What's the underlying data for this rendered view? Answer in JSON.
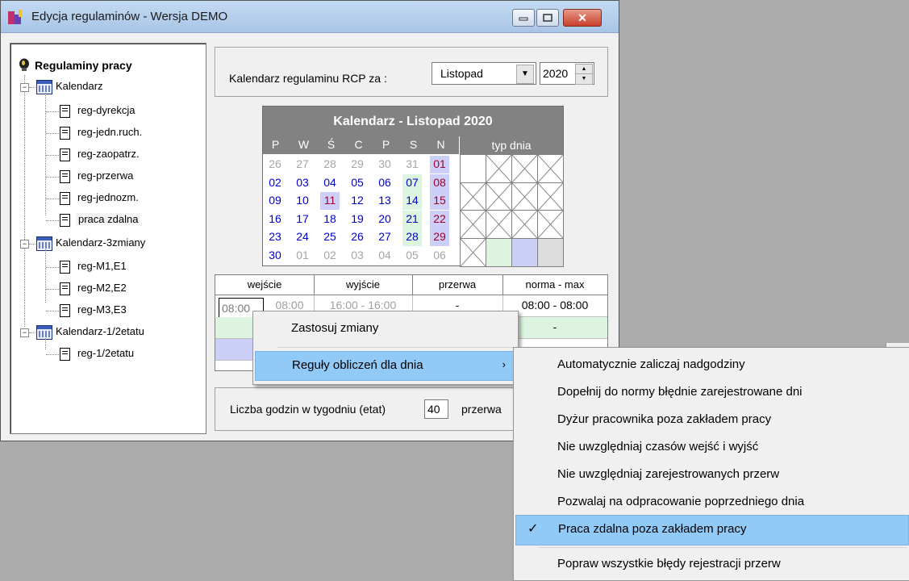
{
  "window": {
    "title": "Edycja regulaminów - Wersja DEMO",
    "buttons": {
      "minimize": "▭",
      "maximize": "▢",
      "close": "✕"
    }
  },
  "tree": {
    "root": "Regulaminy pracy",
    "groups": [
      {
        "label": "Kalendarz",
        "expander": "−",
        "items": [
          "reg-dyrekcja",
          "reg-jedn.ruch.",
          "reg-zaopatrz.",
          "reg-przerwa",
          "reg-jednozm.",
          "praca zdalna"
        ]
      },
      {
        "label": "Kalendarz-3zmiany",
        "expander": "−",
        "items": [
          "reg-M1,E1",
          "reg-M2,E2",
          "reg-M3,E3"
        ]
      },
      {
        "label": "Kalendarz-1/2etatu",
        "expander": "−",
        "items": [
          "reg-1/2etatu"
        ]
      }
    ],
    "selected": "praca zdalna"
  },
  "header": {
    "label": "Kalendarz regulaminu RCP  za :",
    "month": "Listopad",
    "year": "2020",
    "dropdown_arrow": "▼",
    "spin_up": "▲",
    "spin_down": "▼"
  },
  "calendar": {
    "title": "Kalendarz - Listopad 2020",
    "day_names": [
      "P",
      "W",
      "Ś",
      "C",
      "P",
      "S",
      "N"
    ],
    "type_header": "typ dnia",
    "weeks": [
      [
        "26",
        "27",
        "28",
        "29",
        "30",
        "31",
        "01"
      ],
      [
        "02",
        "03",
        "04",
        "05",
        "06",
        "07",
        "08"
      ],
      [
        "09",
        "10",
        "11",
        "12",
        "13",
        "14",
        "15"
      ],
      [
        "16",
        "17",
        "18",
        "19",
        "20",
        "21",
        "22"
      ],
      [
        "23",
        "24",
        "25",
        "26",
        "27",
        "28",
        "29"
      ],
      [
        "30",
        "01",
        "02",
        "03",
        "04",
        "05",
        "06"
      ]
    ],
    "selected_day": "11",
    "colors": {
      "header_bg": "#828282",
      "weekday": "#0000cc",
      "sunday": "#a0002a",
      "saturday_bg": "#ddf5e0",
      "sunday_bg": "#cccff7",
      "muted": "#a5a5a5"
    }
  },
  "schedule": {
    "headers": [
      "wejście",
      "wyjście",
      "przerwa",
      "norma - max"
    ],
    "row1": {
      "entry": "08:00",
      "entry2": "08:00",
      "exit": "16:00 - 16:00",
      "break": "-",
      "norm": "08:00 - 08:00"
    },
    "row2": {
      "norm": "-"
    }
  },
  "bottom": {
    "hours_label": "Liczba godzin w tygodniu (etat)",
    "hours_value": "40",
    "break_label": "przerwa"
  },
  "context_menu": {
    "items": [
      {
        "label": "Zastosuj zmiany"
      },
      {
        "label": "Reguły obliczeń dla dnia",
        "submenu_arrow": "›"
      }
    ]
  },
  "submenu": {
    "items": [
      {
        "label": "Automatycznie zaliczaj nadgodziny",
        "checked": false
      },
      {
        "label": "Dopełnij do normy błędnie zarejestrowane dni",
        "checked": false
      },
      {
        "label": "Dyżur pracownika poza zakładem pracy",
        "checked": false
      },
      {
        "label": "Nie uwzględniaj czasów wejść i wyjść",
        "checked": false
      },
      {
        "label": "Nie uwzględniaj zarejestrowanych przerw",
        "checked": false
      },
      {
        "label": "Pozwalaj na odpracowanie poprzedniego dnia",
        "checked": false
      },
      {
        "label": "Praca zdalna poza zakładem pracy",
        "checked": true
      },
      {
        "label": "Popraw wszystkie błędy rejestracji przerw",
        "checked": false
      }
    ],
    "check_mark": "✓"
  }
}
